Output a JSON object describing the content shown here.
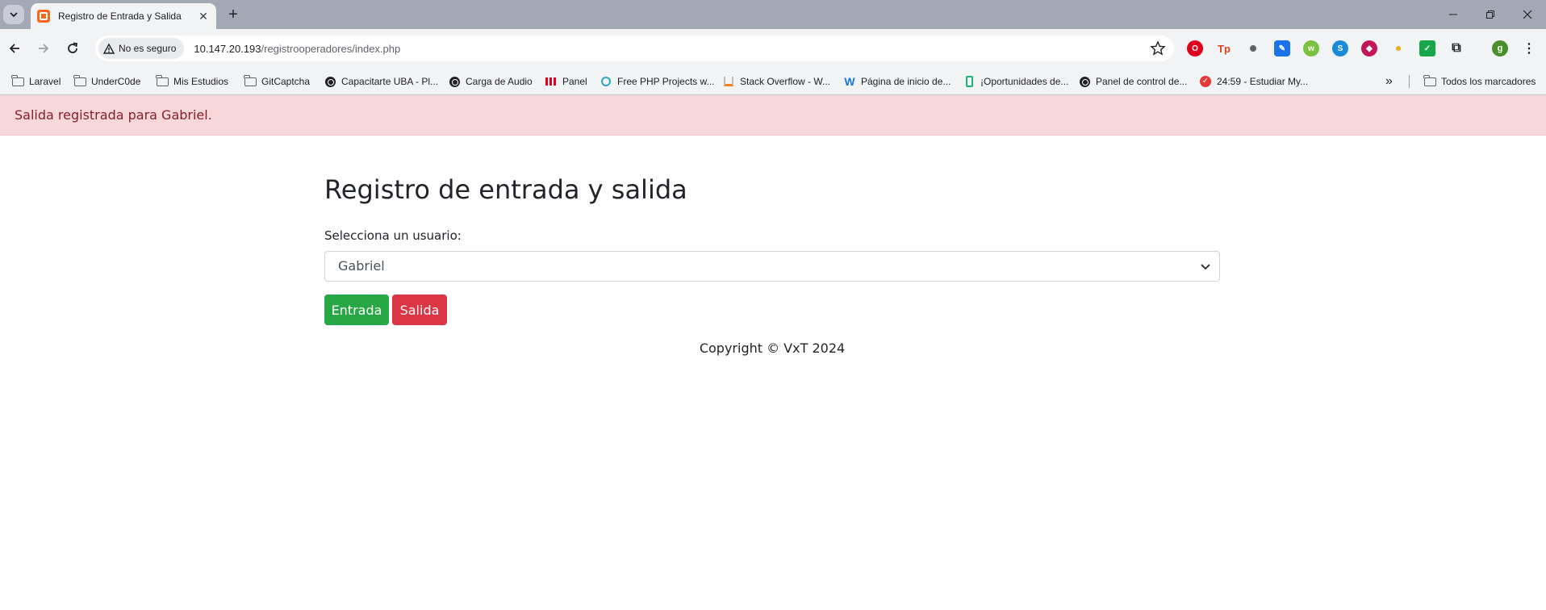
{
  "browser": {
    "tab_title": "Registro de Entrada y Salida",
    "security_label": "No es seguro",
    "url_host": "10.147.20.193",
    "url_path": "/registrooperadores/index.php"
  },
  "bookmarks": {
    "items": [
      {
        "label": "Laravel",
        "icon": "folder-icon"
      },
      {
        "label": "UnderC0de",
        "icon": "folder-icon"
      },
      {
        "label": "Mis Estudios",
        "icon": "folder-icon"
      },
      {
        "label": "GitCaptcha",
        "icon": "folder-icon"
      },
      {
        "label": "Capacitarte UBA - Pl...",
        "icon": "globe-icon"
      },
      {
        "label": "Carga de Audio",
        "icon": "globe-icon"
      },
      {
        "label": "Panel",
        "icon": "panel-favicon"
      },
      {
        "label": "Free PHP Projects w...",
        "icon": "php-favicon"
      },
      {
        "label": "Stack Overflow - W...",
        "icon": "stackoverflow-favicon"
      },
      {
        "label": "Página de inicio de...",
        "icon": "w-favicon"
      },
      {
        "label": "¡Oportunidades de...",
        "icon": "green-favicon"
      },
      {
        "label": "Panel de control de...",
        "icon": "globe-icon"
      },
      {
        "label": "24:59 - Estudiar My...",
        "icon": "check-favicon"
      }
    ],
    "all_bookmarks": "Todos los marcadores"
  },
  "alert": {
    "message": "Salida registrada para Gabriel.",
    "color": "#f8d7da"
  },
  "main": {
    "title": "Registro de entrada y salida",
    "select_label": "Selecciona un usuario:",
    "selected_user": "Gabriel",
    "entrada_label": "Entrada",
    "salida_label": "Salida",
    "footer": "Copyright © VxT 2024"
  },
  "colors": {
    "success": "#28a745",
    "danger": "#dc3545"
  }
}
